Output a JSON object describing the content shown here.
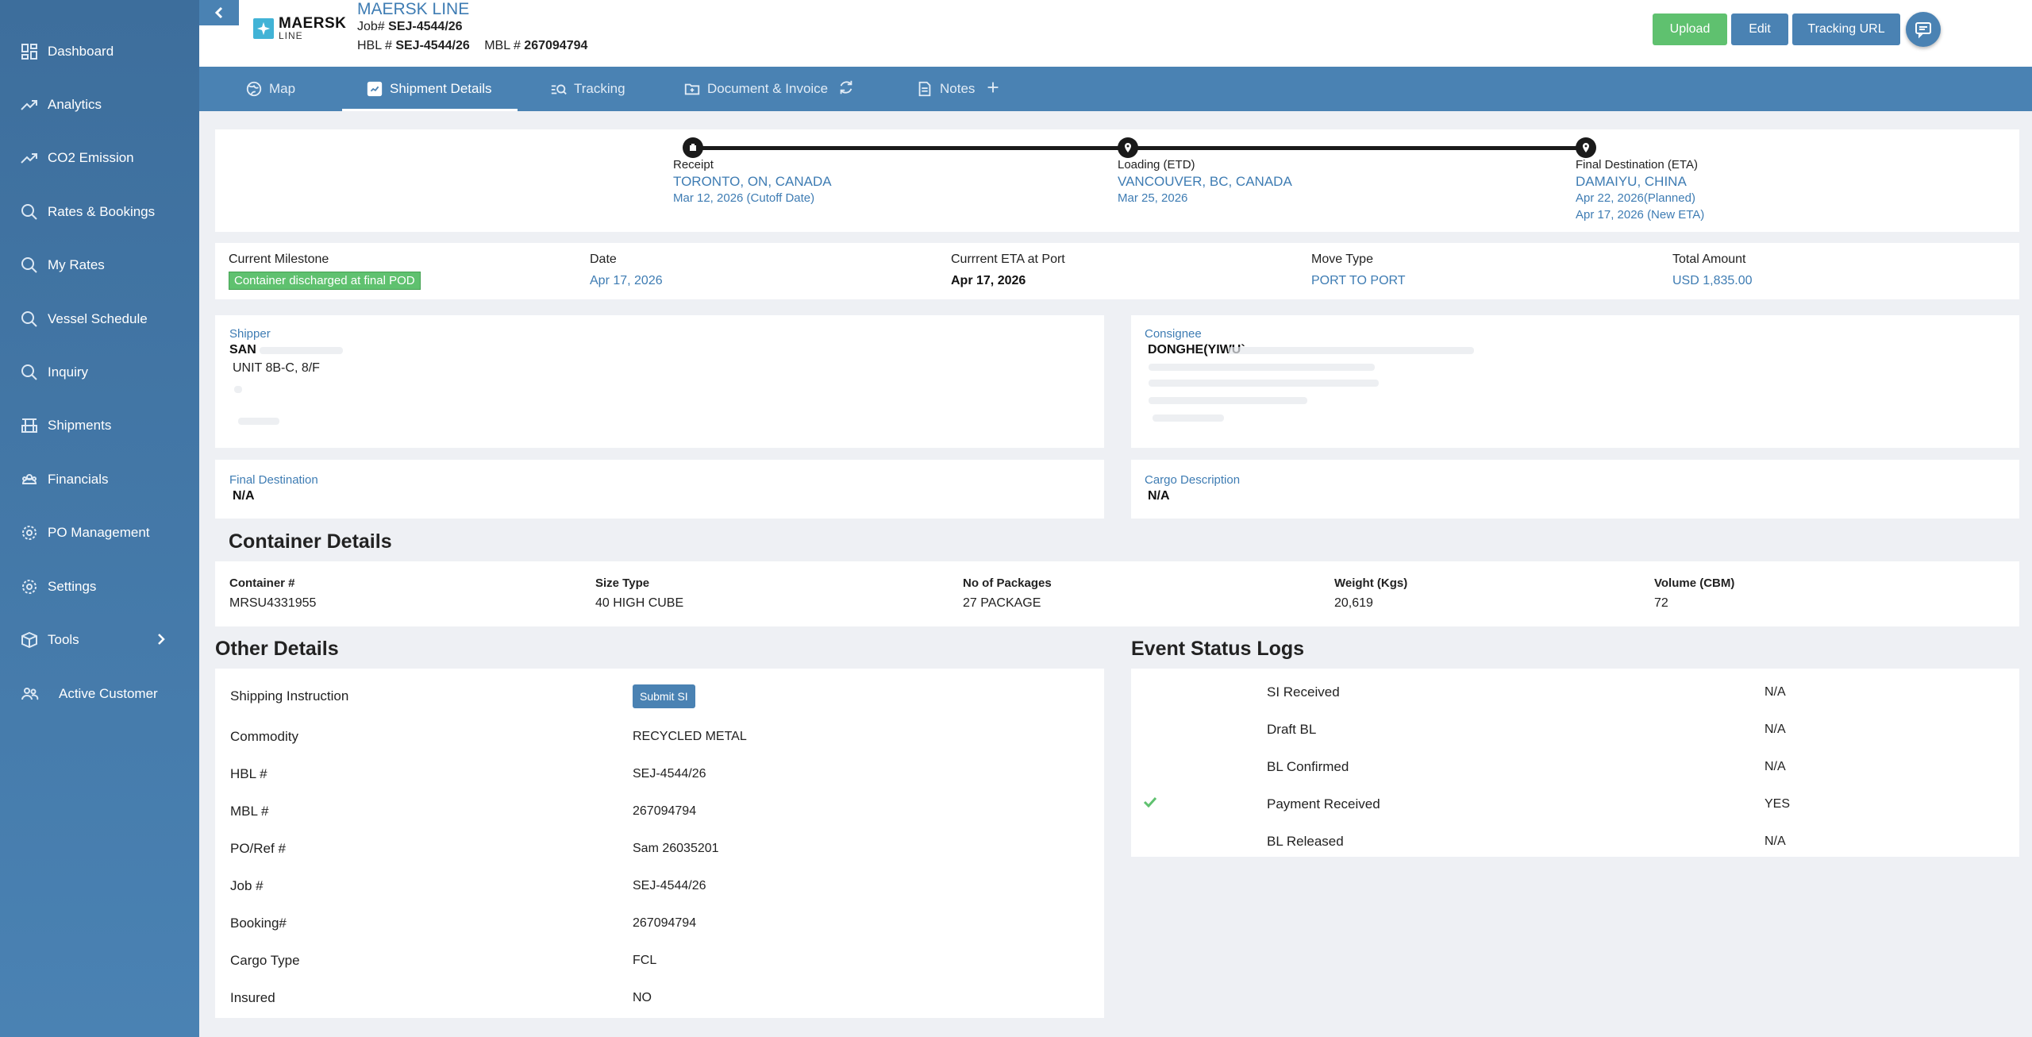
{
  "sidebar": {
    "items": [
      {
        "label": "Dashboard",
        "icon": "dashboard-icon"
      },
      {
        "label": "Analytics",
        "icon": "trend-up-icon"
      },
      {
        "label": "CO2 Emission",
        "icon": "trend-up-icon"
      },
      {
        "label": "Rates & Bookings",
        "icon": "search-icon"
      },
      {
        "label": "My Rates",
        "icon": "search-icon"
      },
      {
        "label": "Vessel Schedule",
        "icon": "search-icon"
      },
      {
        "label": "Inquiry",
        "icon": "search-icon"
      },
      {
        "label": "Shipments",
        "icon": "shipments-icon"
      },
      {
        "label": "Financials",
        "icon": "financials-icon"
      },
      {
        "label": "PO Management",
        "icon": "gear-icon"
      },
      {
        "label": "Settings",
        "icon": "gear-icon"
      },
      {
        "label": "Tools",
        "icon": "box-icon"
      },
      {
        "label": "Active Customer",
        "icon": "users-icon"
      }
    ]
  },
  "header": {
    "logo_top": "MAERSK",
    "logo_bottom": "LINE",
    "carrier": "MAERSK LINE",
    "job_label": "Job#",
    "job_value": "SEJ-4544/26",
    "hbl_label": "HBL #",
    "hbl_value": "SEJ-4544/26",
    "mbl_label": "MBL #",
    "mbl_value": "267094794",
    "upload_label": "Upload",
    "edit_label": "Edit",
    "tracking_url_label": "Tracking URL"
  },
  "tabs": [
    {
      "label": "Map",
      "icon": "globe-icon"
    },
    {
      "label": "Shipment Details",
      "icon": "details-icon"
    },
    {
      "label": "Tracking",
      "icon": "tracking-icon"
    },
    {
      "label": "Document & Invoice",
      "icon": "folder-icon"
    },
    {
      "label": "Notes",
      "icon": "notes-icon"
    }
  ],
  "route": {
    "receipt": {
      "label": "Receipt",
      "city": "TORONTO, ON, CANADA",
      "date1": "Mar 12, 2026 (Cutoff Date)"
    },
    "loading": {
      "label": "Loading (ETD)",
      "city": "VANCOUVER, BC, CANADA",
      "date1": "Mar 25, 2026"
    },
    "final": {
      "label": "Final Destination (ETA)",
      "city": "DAMAIYU, CHINA",
      "date1": "Apr 22, 2026(Planned)",
      "date2": "Apr 17, 2026 (New ETA)"
    }
  },
  "milestone": {
    "current_label": "Current Milestone",
    "current_value": "Container discharged at final POD",
    "date_label": "Date",
    "date_value": "Apr 17, 2026",
    "eta_label": "Currrent ETA at Port",
    "eta_value": "Apr 17, 2026",
    "move_label": "Move Type",
    "move_value": "PORT TO PORT",
    "total_label": "Total Amount",
    "total_value": "USD 1,835.00"
  },
  "shipper": {
    "label": "Shipper",
    "name": "SAN",
    "line1": "UNIT 8B-C, 8/F"
  },
  "consignee": {
    "label": "Consignee",
    "name": "DONGHE(YIWU`"
  },
  "final_destination": {
    "label": "Final Destination",
    "value": "N/A"
  },
  "cargo_description": {
    "label": "Cargo Description",
    "value": "N/A"
  },
  "container_details": {
    "title": "Container Details",
    "headers": [
      "Container #",
      "Size Type",
      "No of Packages",
      "Weight (Kgs)",
      "Volume (CBM)"
    ],
    "values": [
      "MRSU4331955",
      "40 HIGH CUBE",
      "27 PACKAGE",
      "20,619",
      "72"
    ]
  },
  "other_details": {
    "title": "Other Details",
    "submit_si_label": "Submit SI",
    "rows": [
      {
        "key": "Shipping Instruction",
        "value": ""
      },
      {
        "key": "Commodity",
        "value": "RECYCLED METAL"
      },
      {
        "key": "HBL #",
        "value": "SEJ-4544/26"
      },
      {
        "key": "MBL #",
        "value": "267094794"
      },
      {
        "key": "PO/Ref #",
        "value": "Sam 26035201"
      },
      {
        "key": "Job #",
        "value": "SEJ-4544/26"
      },
      {
        "key": "Booking#",
        "value": "267094794"
      },
      {
        "key": "Cargo Type",
        "value": "FCL"
      },
      {
        "key": "Insured",
        "value": "NO"
      }
    ]
  },
  "event_logs": {
    "title": "Event Status Logs",
    "rows": [
      {
        "key": "SI Received",
        "value": "N/A",
        "checked": false
      },
      {
        "key": "Draft BL",
        "value": "N/A",
        "checked": false
      },
      {
        "key": "BL Confirmed",
        "value": "N/A",
        "checked": false
      },
      {
        "key": "Payment Received",
        "value": "YES",
        "checked": true
      },
      {
        "key": "BL Released",
        "value": "N/A",
        "checked": false
      }
    ]
  },
  "colors": {
    "accent": "#4a82b3",
    "success": "#5fc16f",
    "link": "#3e7cb3"
  }
}
